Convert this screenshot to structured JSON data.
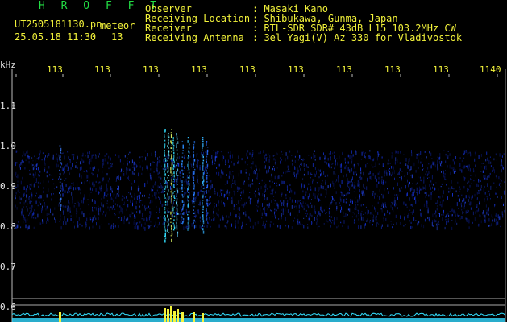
{
  "header": {
    "brand": "H R O F F T",
    "filename": "UT2505181130.pn",
    "event_type": "meteor",
    "datetime": "25.05.18 11:30",
    "count": "13",
    "meta": [
      {
        "label": "Observer",
        "value": ": Masaki Kano"
      },
      {
        "label": "Receiving Location",
        "value": ": Shibukawa, Gunma, Japan"
      },
      {
        "label": "Receiver",
        "value": ": RTL-SDR SDR# 43dB L15 103.2MHz CW"
      },
      {
        "label": "Receiving Antenna",
        "value": ": 3el Yagi(V) Az 330 for Vladivostok"
      }
    ]
  },
  "axis": {
    "y_unit": "kHz",
    "x_ticks": [
      "113",
      "113",
      "113",
      "113",
      "113",
      "113",
      "113",
      "113",
      "113",
      "1140"
    ],
    "y_ticks": [
      "1.1",
      "1.0",
      "0.9",
      "0.8",
      "0.7",
      "0.6"
    ]
  },
  "colors": {
    "background": "#000000",
    "text_yellow": "#f2f23a",
    "brand_green": "#22dd44",
    "noise_blue": "#1a3cff",
    "signal_cyan": "#33e0ff",
    "signal_yellow": "#f4f43a"
  }
}
